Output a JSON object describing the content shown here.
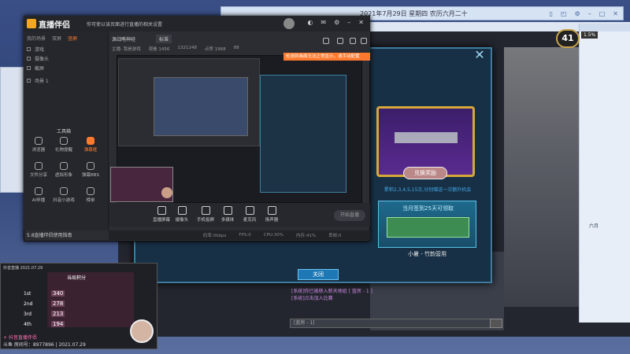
{
  "system_bar": {
    "date": "2021年7月29日 星期四 农历六月二十"
  },
  "right_panel": {
    "label": "六月"
  },
  "level": {
    "value": "41",
    "note": "1.5%"
  },
  "modal": {
    "exchange_button": "兑换奖励",
    "reward_desc": "累积2,3,4,5,15次,分别赠送一次额外机会",
    "monthly_title": "当月签到25天可领取",
    "monthly_caption": "小暑 - 竹韵营用",
    "ok_button": "关闭",
    "chat_line_1": "[系统]你已被移入新天地组 [ 蓝房 - 1 ]",
    "chat_line_2": "[系统]点击加入比赛",
    "chat_input": "[蓝房 - 1]"
  },
  "app": {
    "brand": "直播伴侣",
    "notice": "你可使以该页面进行直播的相关设置",
    "sidebar_tabs": [
      "我的场景",
      "双屏",
      "竖屏"
    ],
    "scenes": [
      "游戏",
      "摄像头",
      "截屏",
      "场景 1"
    ],
    "tools_label": "工具箱",
    "tools": [
      "浏览器",
      "礼物提醒",
      "弹幕框",
      "文件分享",
      "虚拟形象",
      "弹幕BBS",
      "AI伴播",
      "抖音小游戏",
      "榜单"
    ],
    "footer": "5.8直播伴侣使用指南",
    "preview_title": "源战略神经",
    "preview_chip": "标准",
    "preview_stats": [
      "主播: 我是游戏",
      "观看 1456",
      "1321248",
      "点赞 1968",
      "88"
    ],
    "warning": "检测到画面无法正常显示，请手动配置",
    "bottom_buttons": [
      "直播屏幕",
      "摄像头",
      "手机投屏",
      "多媒体",
      "麦克风",
      "扬声器"
    ],
    "start_button": "开始直播",
    "status": [
      "码率:0kbps",
      "FPS:0",
      "CPU:30%",
      "内存:41%",
      "丢帧:0"
    ]
  },
  "overlay": {
    "header": "抖音直播 2021.07.29",
    "board_title": "当局积分",
    "ranks": [
      "1st",
      "2nd",
      "3rd",
      "4th"
    ],
    "scores": [
      "340",
      "278",
      "213",
      "194"
    ],
    "tag": "+ 抖音直播伴侣",
    "id": "斗鱼 房间号：8977896 | 2021.07.29"
  }
}
